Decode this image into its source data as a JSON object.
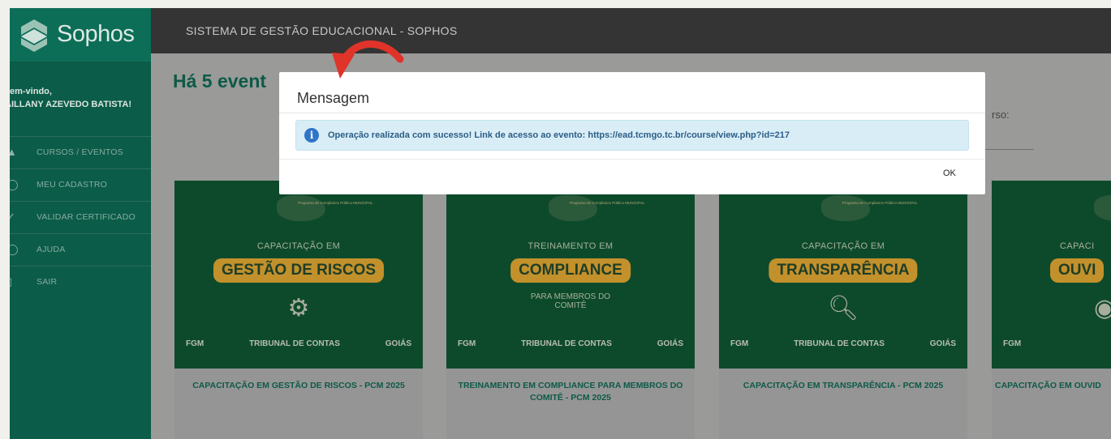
{
  "sidebar": {
    "brand": "Sophos",
    "welcome": "em-vindo,",
    "user": "AILLANY AZEVEDO BATISTA!",
    "items": [
      {
        "label": "CURSOS / EVENTOS",
        "icon": "graduation-cap-icon"
      },
      {
        "label": "MEU CADASTRO",
        "icon": "user-icon"
      },
      {
        "label": "VALIDAR CERTIFICADO",
        "icon": "check-icon"
      },
      {
        "label": "AJUDA",
        "icon": "help-icon"
      },
      {
        "label": "SAIR",
        "icon": "logout-icon"
      }
    ]
  },
  "topbar": {
    "title": "SISTEMA DE GESTÃO EDUCACIONAL - SOPHOS"
  },
  "main": {
    "heading": "Há 5 event",
    "right_label": "rso:"
  },
  "cards": [
    {
      "program": "Programa de Compliance Público MUNICIPAL",
      "line1": "CAPACITAÇÃO EM",
      "pill": "GESTÃO DE RISCOS",
      "line3": "",
      "title": "CAPACITAÇÃO EM GESTÃO DE RISCOS - PCM 2025"
    },
    {
      "program": "Programa de Compliance Público MUNICIPAL",
      "line1": "TREINAMENTO EM",
      "pill": "COMPLIANCE",
      "line3": "PARA MEMBROS DO COMITÊ",
      "title": "TREINAMENTO EM COMPLIANCE PARA MEMBROS DO COMITÊ - PCM 2025"
    },
    {
      "program": "Programa de Compliance Público MUNICIPAL",
      "line1": "CAPACITAÇÃO EM",
      "pill": "TRANSPARÊNCIA",
      "line3": "",
      "title": "CAPACITAÇÃO EM TRANSPARÊNCIA - PCM 2025"
    },
    {
      "program": "",
      "line1": "CAPACI",
      "pill": "OUVI",
      "line3": "",
      "title": "CAPACITAÇÃO EM OUVID"
    }
  ],
  "card_logos": [
    "FGM",
    "TRIBUNAL DE CONTAS",
    "GOIÁS"
  ],
  "modal": {
    "title": "Mensagem",
    "message": "Operação realizada com sucesso! Link de acesso ao evento: https://ead.tcmgo.tc.br/course/view.php?id=217",
    "ok": "OK",
    "info_icon_glyph": "i"
  },
  "colors": {
    "sidebar": "#0b5c48",
    "topbar": "#343434",
    "accent_green": "#0d5a47",
    "pill_gold": "#c2912c",
    "alert_bg": "#d9edf7",
    "arrow_red": "#e0332a"
  }
}
